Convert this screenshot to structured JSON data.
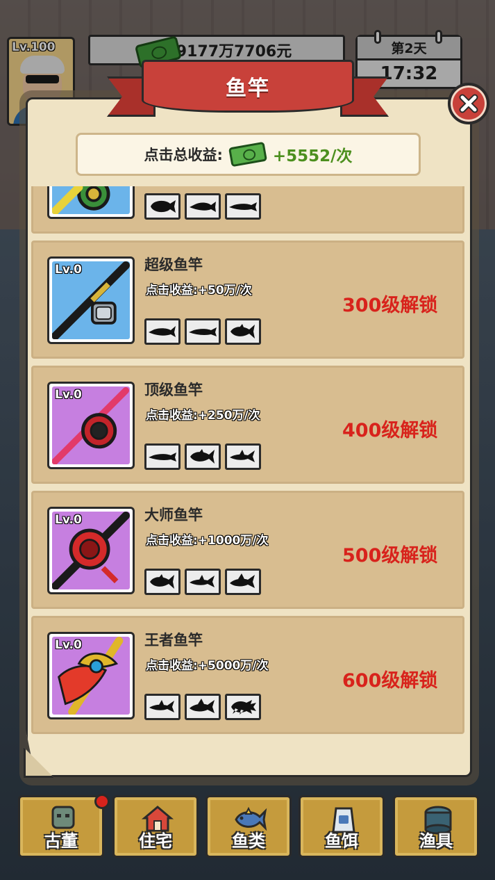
{
  "hud": {
    "player_level": "Lv.100",
    "money": "9177万7706元",
    "day": "第2天",
    "time": "17:32"
  },
  "modal": {
    "title": "鱼竿",
    "total_income_label": "点击总收益:",
    "total_income_value": "+5552/次"
  },
  "rods": [
    {
      "name": "",
      "level": "",
      "income": "",
      "lock": "",
      "fish_icons": [
        "arowana-silhouette-icon",
        "catfish-silhouette-icon",
        "longfish-silhouette-icon"
      ],
      "art_color": "#6bb4ea"
    },
    {
      "name": "超级鱼竿",
      "level": "Lv.0",
      "income": "点击收益:+50万/次",
      "lock": "300级解锁",
      "fish_icons": [
        "sturgeon-silhouette-icon",
        "longfish-silhouette-icon",
        "tuna-silhouette-icon"
      ],
      "art_color": "#6bb4ea"
    },
    {
      "name": "顶级鱼竿",
      "level": "Lv.0",
      "income": "点击收益:+250万/次",
      "lock": "400级解锁",
      "fish_icons": [
        "longfish-silhouette-icon",
        "tuna-silhouette-icon",
        "shark-silhouette-icon"
      ],
      "art_color": "#c67fe0"
    },
    {
      "name": "大师鱼竿",
      "level": "Lv.0",
      "income": "点击收益:+1000万/次",
      "lock": "500级解锁",
      "fish_icons": [
        "tuna-silhouette-icon",
        "shark-silhouette-icon",
        "great-shark-silhouette-icon"
      ],
      "art_color": "#c67fe0"
    },
    {
      "name": "王者鱼竿",
      "level": "Lv.0",
      "income": "点击收益:+5000万/次",
      "lock": "600级解锁",
      "fish_icons": [
        "shark-silhouette-icon",
        "great-shark-silhouette-icon",
        "sea-monster-silhouette-icon"
      ],
      "art_color": "#c67fe0"
    }
  ],
  "bottom_nav": [
    {
      "label": "古董",
      "icon": "antique-icon",
      "badge": true
    },
    {
      "label": "住宅",
      "icon": "house-icon",
      "badge": false
    },
    {
      "label": "鱼类",
      "icon": "fish-icon",
      "badge": false
    },
    {
      "label": "鱼饵",
      "icon": "bait-icon",
      "badge": false
    },
    {
      "label": "渔具",
      "icon": "reel-icon",
      "badge": false
    }
  ],
  "colors": {
    "lock_text": "#d8231c",
    "income_value": "#4c8f1e",
    "ribbon": "#c8413a",
    "card_bg": "#d8bd90",
    "nav_btn": "#c59b3d"
  }
}
